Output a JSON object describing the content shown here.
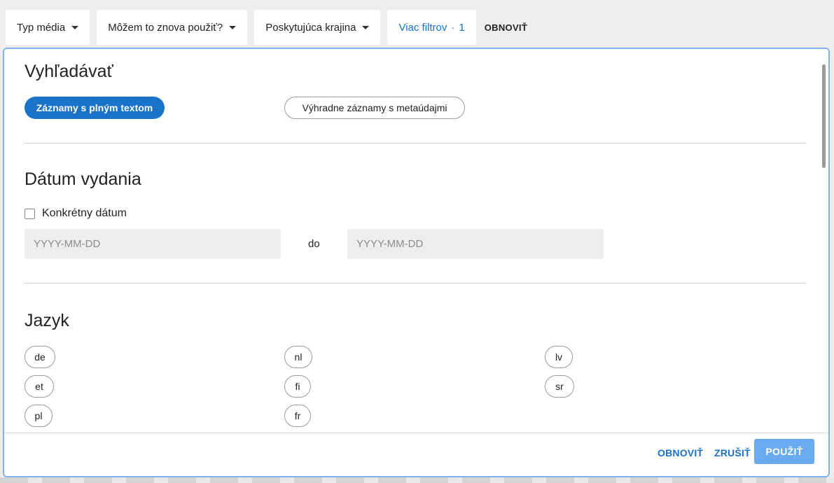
{
  "filters": {
    "media_type": "Typ média",
    "reuse": "Môžem to znova použiť?",
    "country": "Poskytujúca krajina",
    "more_filters": "Viac filtrov",
    "more_filters_dot": "·",
    "more_filters_count": "1",
    "reset": "OBNOVIŤ"
  },
  "search": {
    "title": "Vyhľadávať",
    "option_fulltext": "Záznamy s plným textom",
    "option_metadata": "Výhradne záznamy s metaúdajmi",
    "selected": "Záznamy s plným textom"
  },
  "date": {
    "title": "Dátum vydania",
    "specific_date_label": "Konkrétny dátum",
    "specific_date_checked": false,
    "from_placeholder": "YYYY-MM-DD",
    "separator": "do",
    "to_placeholder": "YYYY-MM-DD"
  },
  "language": {
    "title": "Jazyk",
    "items": [
      "de",
      "nl",
      "lv",
      "et",
      "fi",
      "sr",
      "pl",
      "fr"
    ]
  },
  "footer": {
    "reset": "OBNOVIŤ",
    "cancel": "ZRUŠIŤ",
    "apply": "POUŽIŤ"
  },
  "colors": {
    "accent": "#1a73c8",
    "apply_button": "#6aaaf0",
    "panel_border": "#7fb2ec"
  }
}
